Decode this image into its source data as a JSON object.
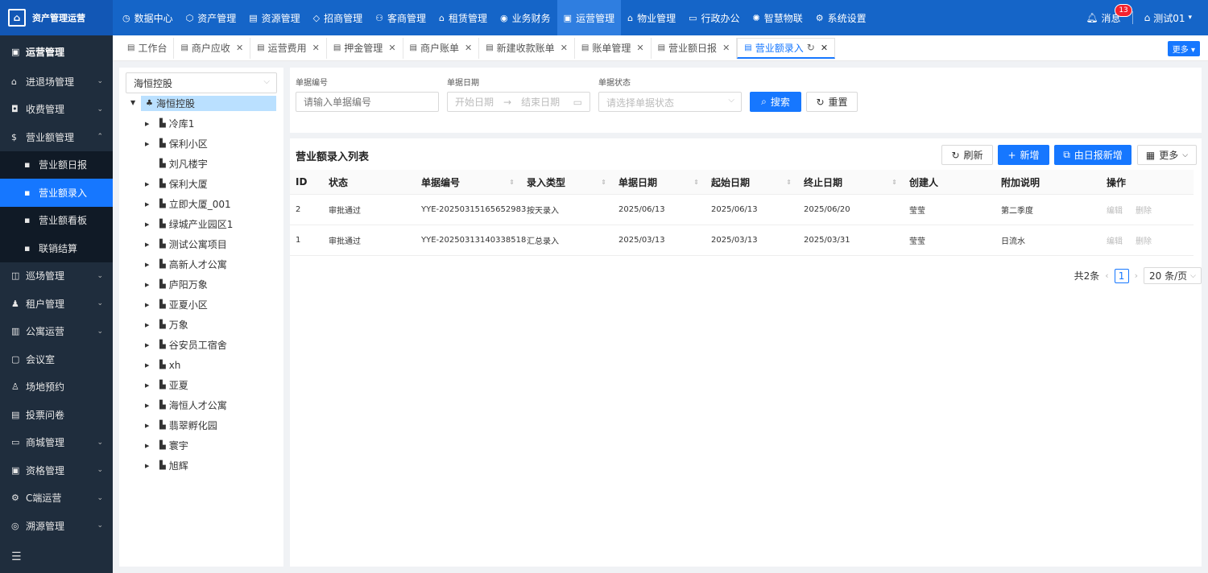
{
  "app": {
    "title": "资产管理运营"
  },
  "topnav": [
    {
      "label": "数据中心",
      "icon": "dashboard-icon"
    },
    {
      "label": "资产管理",
      "icon": "cube-icon"
    },
    {
      "label": "资源管理",
      "icon": "document-icon"
    },
    {
      "label": "招商管理",
      "icon": "tag-icon"
    },
    {
      "label": "客商管理",
      "icon": "user-icon"
    },
    {
      "label": "租赁管理",
      "icon": "home-icon"
    },
    {
      "label": "业务财务",
      "icon": "money-icon"
    },
    {
      "label": "运营管理",
      "icon": "chart-icon",
      "active": true
    },
    {
      "label": "物业管理",
      "icon": "house-icon"
    },
    {
      "label": "行政办公",
      "icon": "monitor-icon"
    },
    {
      "label": "智慧物联",
      "icon": "sun-icon"
    },
    {
      "label": "系统设置",
      "icon": "gear-icon"
    }
  ],
  "header": {
    "messages_label": "消息",
    "messages_count": "13",
    "user_name": "测试01"
  },
  "sidebar": {
    "title": "运营管理",
    "items": [
      {
        "label": "进退场管理",
        "expandable": true
      },
      {
        "label": "收费管理",
        "expandable": true
      },
      {
        "label": "营业额管理",
        "expandable": true,
        "expanded": true
      },
      {
        "label": "营业额日报",
        "sub": true
      },
      {
        "label": "营业额录入",
        "sub": true,
        "active": true
      },
      {
        "label": "营业额看板",
        "sub": true
      },
      {
        "label": "联销结算",
        "sub": true
      },
      {
        "label": "巡场管理",
        "expandable": true
      },
      {
        "label": "租户管理",
        "expandable": true
      },
      {
        "label": "公寓运营",
        "expandable": true
      },
      {
        "label": "会议室",
        "expandable": false
      },
      {
        "label": "场地预约",
        "expandable": false
      },
      {
        "label": "投票问卷",
        "expandable": false
      },
      {
        "label": "商城管理",
        "expandable": true
      },
      {
        "label": "资格管理",
        "expandable": true
      },
      {
        "label": "C端运营",
        "expandable": true
      },
      {
        "label": "溯源管理",
        "expandable": true
      }
    ]
  },
  "tabs": [
    {
      "label": "工作台",
      "closable": false
    },
    {
      "label": "商户应收",
      "closable": true
    },
    {
      "label": "运营费用",
      "closable": true
    },
    {
      "label": "押金管理",
      "closable": true
    },
    {
      "label": "商户账单",
      "closable": true
    },
    {
      "label": "新建收款账单",
      "closable": true
    },
    {
      "label": "账单管理",
      "closable": true
    },
    {
      "label": "营业额日报",
      "closable": true
    },
    {
      "label": "营业额录入",
      "closable": true,
      "active": true
    }
  ],
  "tabs_more": "更多",
  "tree": {
    "selected": "海恒控股",
    "root": "海恒控股",
    "nodes": [
      {
        "label": "冷库1",
        "has_children": true
      },
      {
        "label": "保利小区",
        "has_children": true
      },
      {
        "label": "刘凡楼宇",
        "has_children": false
      },
      {
        "label": "保利大厦",
        "has_children": true
      },
      {
        "label": "立即大厦_001",
        "has_children": true
      },
      {
        "label": "绿城产业园区1",
        "has_children": true
      },
      {
        "label": "测试公寓项目",
        "has_children": true
      },
      {
        "label": "高新人才公寓",
        "has_children": true
      },
      {
        "label": "庐阳万象",
        "has_children": true
      },
      {
        "label": "亚夏小区",
        "has_children": true
      },
      {
        "label": "万象",
        "has_children": true
      },
      {
        "label": "谷安员工宿舍",
        "has_children": true
      },
      {
        "label": "xh",
        "has_children": true
      },
      {
        "label": "亚夏",
        "has_children": true
      },
      {
        "label": "海恒人才公寓",
        "has_children": true
      },
      {
        "label": "翡翠孵化园",
        "has_children": true
      },
      {
        "label": "寰宇",
        "has_children": true
      },
      {
        "label": "旭辉",
        "has_children": true
      }
    ]
  },
  "search": {
    "doc_no_label": "单据编号",
    "doc_no_placeholder": "请输入单据编号",
    "doc_date_label": "单据日期",
    "start_placeholder": "开始日期",
    "end_placeholder": "结束日期",
    "status_label": "单据状态",
    "status_placeholder": "请选择单据状态",
    "search_btn": "搜索",
    "reset_btn": "重置"
  },
  "list": {
    "title": "营业额录入列表",
    "refresh_btn": "刷新",
    "add_btn": "新增",
    "from_daily_btn": "由日报新增",
    "more_btn": "更多",
    "columns": [
      "ID",
      "状态",
      "单据编号",
      "录入类型",
      "单据日期",
      "起始日期",
      "终止日期",
      "创建人",
      "附加说明",
      "操作"
    ],
    "rows": [
      {
        "id": "2",
        "status": "审批通过",
        "doc_no": "YYE-20250315165652983",
        "type": "按天录入",
        "doc_date": "2025/06/13",
        "start": "2025/06/13",
        "end": "2025/06/20",
        "creator": "莹莹",
        "note": "第二季度",
        "edit": "编辑",
        "delete": "删除"
      },
      {
        "id": "1",
        "status": "审批通过",
        "doc_no": "YYE-20250313140338518",
        "type": "汇总录入",
        "doc_date": "2025/03/13",
        "start": "2025/03/13",
        "end": "2025/03/31",
        "creator": "莹莹",
        "note": "日流水",
        "edit": "编辑",
        "delete": "删除"
      }
    ]
  },
  "pagination": {
    "total": "共2条",
    "page": "1",
    "page_size": "20 条/页"
  }
}
